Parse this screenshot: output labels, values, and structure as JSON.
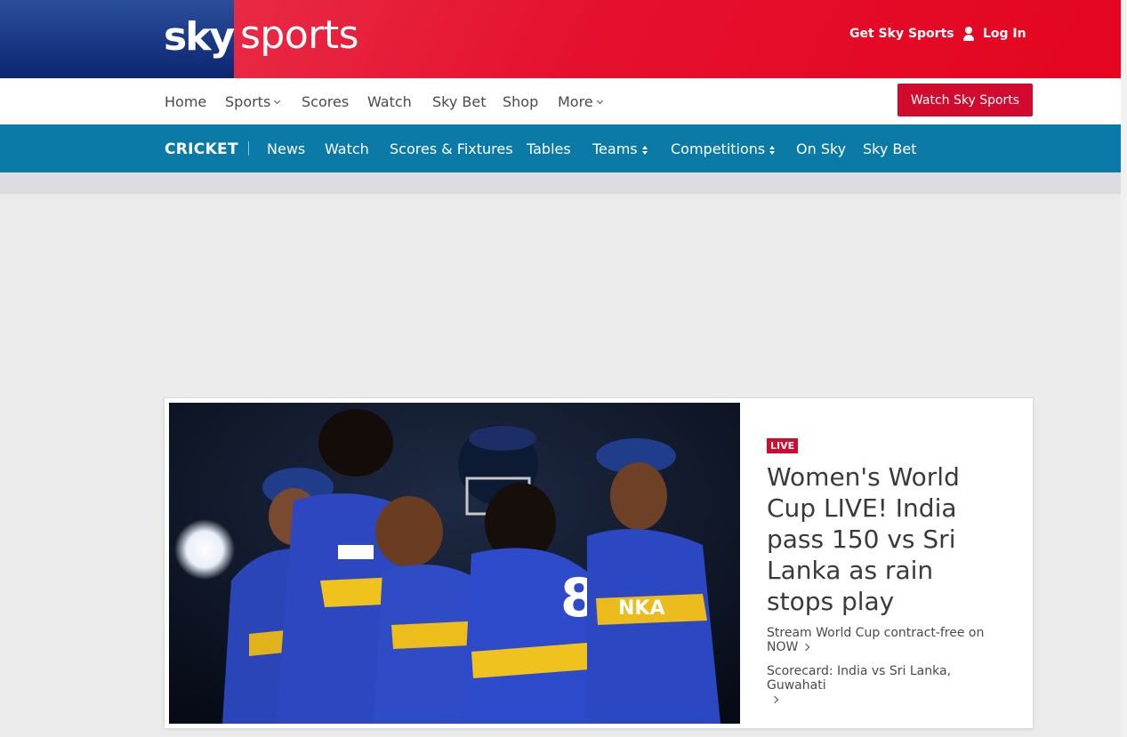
{
  "header": {
    "logo_sky": "sky",
    "logo_sports": "sports",
    "get_sky_sports": "Get Sky Sports",
    "log_in": "Log In"
  },
  "main_nav": {
    "items": [
      "Home",
      "Sports",
      "Scores",
      "Watch",
      "Sky Bet",
      "Shop",
      "More"
    ],
    "cta": "Watch Sky Sports"
  },
  "section_nav": {
    "section": "CRICKET",
    "items": [
      "News",
      "Watch",
      "Scores & Fixtures",
      "Tables",
      "Teams",
      "Competitions",
      "On Sky",
      "Sky Bet"
    ]
  },
  "hero": {
    "badge": "LIVE",
    "headline": "Women's World Cup LIVE! India pass 150 vs Sri Lanka as rain stops play",
    "related": [
      "Stream World Cup contract-free on NOW",
      "Scorecard: India vs Sri Lanka, Guwahati"
    ]
  },
  "colors": {
    "brand_red": "#e60a2a",
    "brand_blue": "#1a3784",
    "cricket_blue": "#0c7aa6",
    "cta_red": "#d10a2e"
  }
}
